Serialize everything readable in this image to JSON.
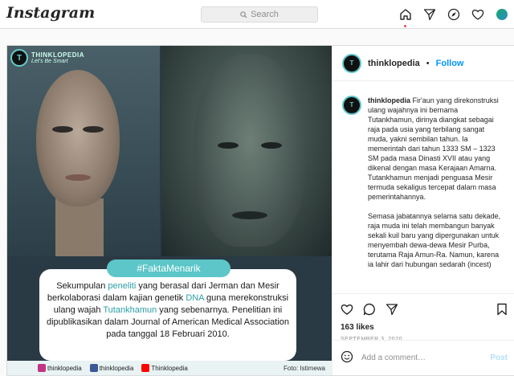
{
  "app": {
    "logo": "Instagram"
  },
  "search": {
    "placeholder": "Search"
  },
  "nav": {
    "icons": [
      "home-icon",
      "direct-icon",
      "explore-icon",
      "activity-icon",
      "avatar"
    ]
  },
  "media": {
    "brand": "THINKLOPEDIA",
    "brand_sub": "Let's Be Smart",
    "hashtag": "#FaktaMenarik",
    "text_parts": [
      {
        "t": "Sekumpulan ",
        "hl": false
      },
      {
        "t": "peneliti",
        "hl": true
      },
      {
        "t": " yang berasal dari Jerman dan Mesir berkolaborasi dalam kajian genetik ",
        "hl": false
      },
      {
        "t": "DNA",
        "hl": true
      },
      {
        "t": " guna merekonstruksi ulang wajah ",
        "hl": false
      },
      {
        "t": "Tutankhamun",
        "hl": true
      },
      {
        "t": " yang sebenarnya. Penelitian ini dipublikasikan dalam Journal of American Medical Association pada tanggal 18 Februari 2010.",
        "hl": false
      }
    ],
    "socials": [
      {
        "label": "thinklopedia",
        "color": "#c13584"
      },
      {
        "label": "thinklopedia",
        "color": "#3b5998"
      },
      {
        "label": "Thinklopedia",
        "color": "#ff0000"
      }
    ],
    "credit": "Foto: Istimewa"
  },
  "post": {
    "username": "thinklopedia",
    "follow_sep": "•",
    "follow_label": "Follow",
    "caption_p1": "Fir'aun yang direkonstruksi ulang wajahnya ini bernama Tutankhamun, dirinya diangkat sebagai raja pada usia yang terbilang sangat muda, yakni sembilan tahun. Ia memerintah dari tahun 1333 SM – 1323 SM pada masa Dinasti XVII atau yang dikenal dengan masa Kerajaan Amarna. Tutankhamun menjadi penguasa Mesir termuda sekaligus tercepat dalam masa pemerintahannya.",
    "caption_p2": "Semasa jabatannya selama satu dekade, raja muda ini telah membangun banyak sekali kuil baru yang dipergunakan untuk menyembah dewa-dewa Mesir Purba, terutama Raja Amun-Ra. Namun, karena ia lahir dari hubungan sedarah (incest)",
    "likes": "163 likes",
    "date": "SEPTEMBER 3, 2020",
    "comment_placeholder": "Add a comment…",
    "post_label": "Post"
  }
}
